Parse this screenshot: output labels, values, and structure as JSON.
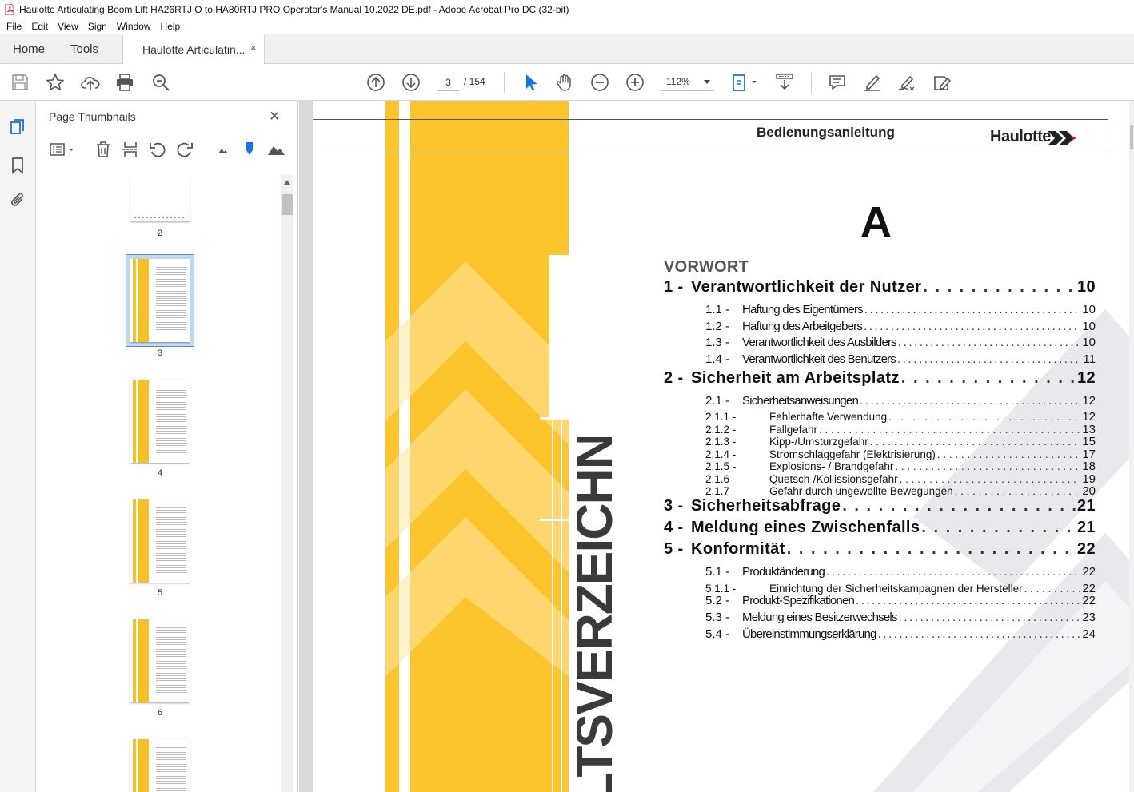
{
  "window": {
    "title": "Haulotte Articulating Boom Lift HA26RTJ O to HA80RTJ PRO Operator's Manual 10.2022 DE.pdf - Adobe Acrobat Pro DC (32-bit)"
  },
  "menu": [
    "File",
    "Edit",
    "View",
    "Sign",
    "Window",
    "Help"
  ],
  "tabs": {
    "home": "Home",
    "tools": "Tools",
    "document": "Haulotte Articulatin...",
    "close": "×"
  },
  "toolbar": {
    "page_current": "3",
    "page_total": "/  154",
    "zoom": "112%"
  },
  "thumbnails": {
    "title": "Page Thumbnails",
    "close": "✕",
    "selected_page": 3,
    "pages": [
      {
        "label": "2"
      },
      {
        "label": "3"
      },
      {
        "label": "4"
      },
      {
        "label": "5"
      },
      {
        "label": "6"
      }
    ]
  },
  "document": {
    "header_title": "Bedienungsanleitung",
    "brand": "Haulotte",
    "brand_color": "#e30613",
    "accent_yellow": "#fdc42b",
    "section_letter": "A",
    "vertical_title": "LTSVERZEICHNIS",
    "preface": "VORWORT",
    "toc": [
      {
        "level": 1,
        "num": "1 -",
        "label": "Verantwortlichkeit der Nutzer",
        "page": "10"
      },
      {
        "level": 2,
        "num": "1.1 -",
        "label": "Haftung des Eigentümers",
        "page": "10"
      },
      {
        "level": 2,
        "num": "1.2 -",
        "label": "Haftung des Arbeitgebers",
        "page": "10"
      },
      {
        "level": 2,
        "num": "1.3 -",
        "label": "Verantwortlichkeit des Ausbilders",
        "page": "10"
      },
      {
        "level": 2,
        "num": "1.4 -",
        "label": "Verantwortlichkeit des Benutzers",
        "page": "11"
      },
      {
        "level": 1,
        "num": "2 -",
        "label": "Sicherheit am Arbeitsplatz",
        "page": "12"
      },
      {
        "level": 2,
        "num": "2.1 -",
        "label": "Sicherheitsanweisungen",
        "page": "12"
      },
      {
        "level": 3,
        "num": "2.1.1 -",
        "label": "Fehlerhafte Verwendung",
        "page": "12"
      },
      {
        "level": 3,
        "num": "2.1.2 -",
        "label": "Fallgefahr",
        "page": "13"
      },
      {
        "level": 3,
        "num": "2.1.3 -",
        "label": "Kipp-/Umsturzgefahr",
        "page": "15"
      },
      {
        "level": 3,
        "num": "2.1.4 -",
        "label": "Stromschlaggefahr (Elektrisierung)",
        "page": "17"
      },
      {
        "level": 3,
        "num": "2.1.5 -",
        "label": "Explosions- / Brandgefahr",
        "page": "18"
      },
      {
        "level": 3,
        "num": "2.1.6 -",
        "label": "Quetsch-/Kollissionsgefahr",
        "page": "19"
      },
      {
        "level": 3,
        "num": "2.1.7 -",
        "label": "Gefahr durch ungewollte Bewegungen",
        "page": "20"
      },
      {
        "level": 1,
        "num": "3 -",
        "label": "Sicherheitsabfrage",
        "page": "21"
      },
      {
        "level": 1,
        "num": "4 -",
        "label": "Meldung eines Zwischenfalls",
        "page": "21"
      },
      {
        "level": 1,
        "num": "5 -",
        "label": "Konformität",
        "page": "22"
      },
      {
        "level": 2,
        "num": "5.1 -",
        "label": "Produktänderung",
        "page": "22"
      },
      {
        "level": 3,
        "num": "5.1.1 -",
        "label": "Einrichtung der Sicherheitskampagnen der Hersteller",
        "page": "22"
      },
      {
        "level": 2,
        "num": "5.2 -",
        "label": "Produkt-Spezifikationen",
        "page": "22"
      },
      {
        "level": 2,
        "num": "5.3 -",
        "label": "Meldung eines Besitzerwechsels",
        "page": "23"
      },
      {
        "level": 2,
        "num": "5.4 -",
        "label": "Übereinstimmungserklärung",
        "page": "24"
      }
    ]
  }
}
